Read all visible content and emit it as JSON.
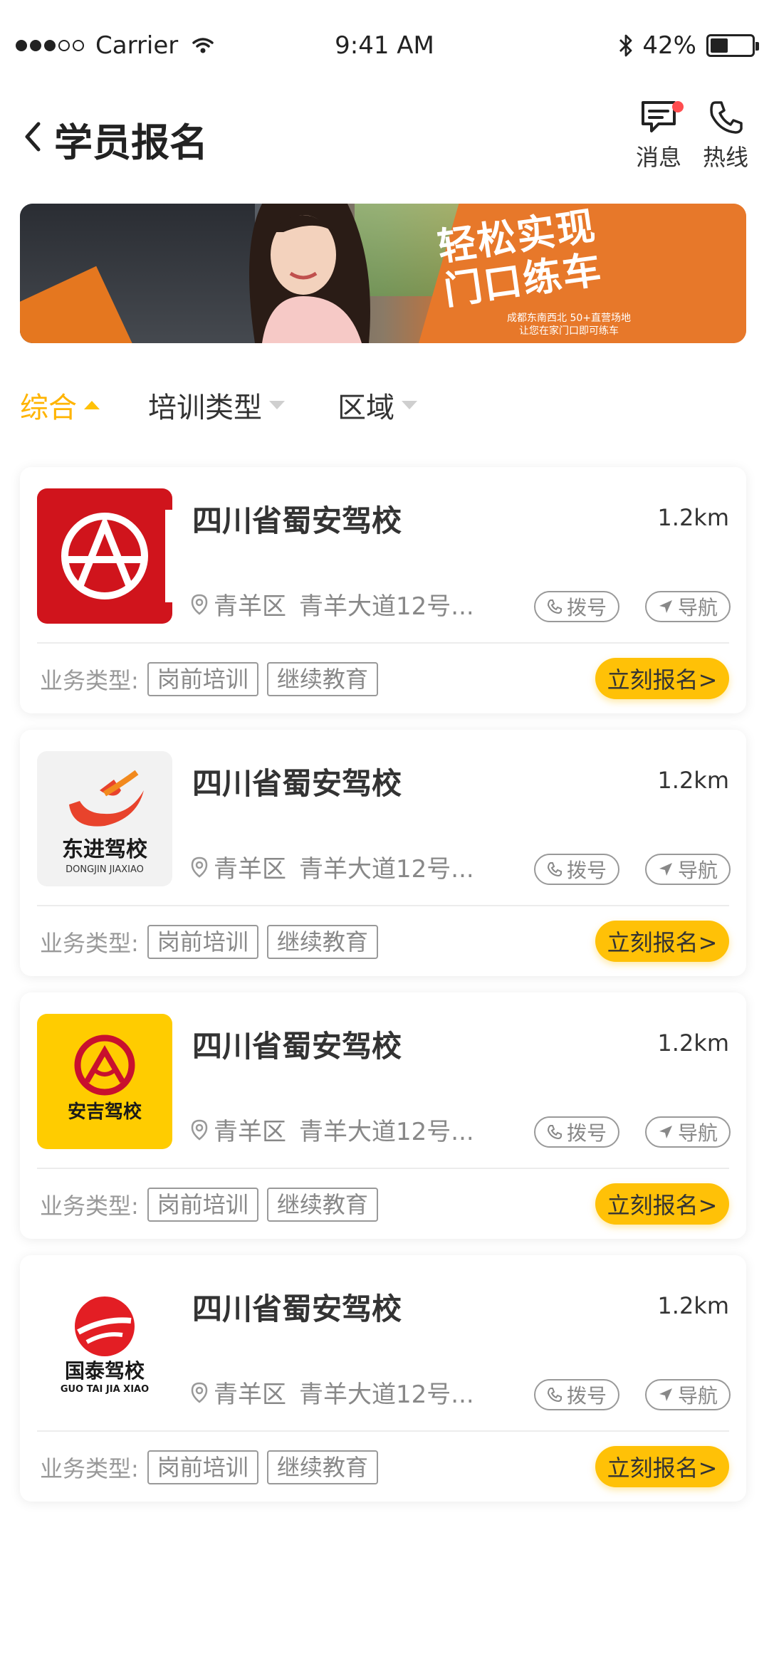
{
  "status_bar": {
    "carrier": "Carrier",
    "time": "9:41 AM",
    "battery": "42%",
    "battery_level": 0.42
  },
  "header": {
    "title": "学员报名",
    "messages_label": "消息",
    "hotline_label": "热线"
  },
  "banner": {
    "headline_1": "轻松实现",
    "headline_2": "门口练车",
    "sub_1": "成都东南西北 50+直营场地",
    "sub_2": "让您在家门口即可练车"
  },
  "filters": [
    {
      "label": "综合"
    },
    {
      "label": "培训类型"
    },
    {
      "label": "区域"
    }
  ],
  "schools": [
    {
      "name": "四川省蜀安驾校",
      "distance": "1.2km",
      "district": "青羊区",
      "address": "青羊大道12号...",
      "call": "拨号",
      "nav": "导航",
      "biz_label": "业务类型:",
      "tags": [
        "岗前培训",
        "继续教育"
      ],
      "enroll": "立刻报名>",
      "logo_text": ""
    },
    {
      "name": "四川省蜀安驾校",
      "distance": "1.2km",
      "district": "青羊区",
      "address": "青羊大道12号...",
      "call": "拨号",
      "nav": "导航",
      "biz_label": "业务类型:",
      "tags": [
        "岗前培训",
        "继续教育"
      ],
      "enroll": "立刻报名>",
      "logo_text": "东进驾校",
      "logo_sub": "DONGJIN JIAXIAO"
    },
    {
      "name": "四川省蜀安驾校",
      "distance": "1.2km",
      "district": "青羊区",
      "address": "青羊大道12号...",
      "call": "拨号",
      "nav": "导航",
      "biz_label": "业务类型:",
      "tags": [
        "岗前培训",
        "继续教育"
      ],
      "enroll": "立刻报名>",
      "logo_text": "安吉驾校"
    },
    {
      "name": "四川省蜀安驾校",
      "distance": "1.2km",
      "district": "青羊区",
      "address": "青羊大道12号...",
      "call": "拨号",
      "nav": "导航",
      "biz_label": "业务类型:",
      "tags": [
        "岗前培训",
        "继续教育"
      ],
      "enroll": "立刻报名>",
      "logo_text": "国泰驾校",
      "logo_sub": "GUO TAI JIA XIAO"
    }
  ],
  "colors": {
    "accent": "#ffc107",
    "active_filter": "#ffb400",
    "logo_red": "#d0141c",
    "logo_yellow": "#ffcc00"
  }
}
